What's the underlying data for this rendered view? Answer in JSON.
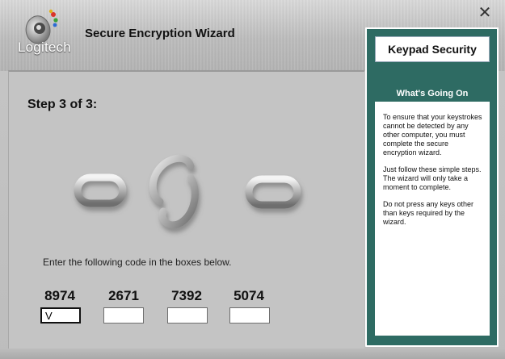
{
  "header": {
    "logo_text": "Logitech",
    "title": "Secure Encryption Wizard",
    "close_glyph": "✕"
  },
  "main": {
    "step": "Step 3 of 3:",
    "instruction": "Enter the following code in the boxes below.",
    "codes": [
      {
        "code": "8974",
        "input_value": "V"
      },
      {
        "code": "2671",
        "input_value": ""
      },
      {
        "code": "7392",
        "input_value": ""
      },
      {
        "code": "5074",
        "input_value": ""
      }
    ]
  },
  "side_panel": {
    "title": "Keypad Security",
    "subtitle": "What's Going On",
    "paragraphs": [
      "To ensure that your keystrokes cannot be detected by any other computer, you must complete the secure encryption wizard.",
      "Just follow these simple steps. The wizard will only take a moment to complete.",
      "Do not press any keys other than keys required by the wizard."
    ]
  },
  "icons": {
    "logo": "logitech-logo-icon",
    "close": "close-icon",
    "chain": "chain-link-icon"
  },
  "colors": {
    "panel_teal": "#2e6b63",
    "panel_bg": "#c4c4c4"
  }
}
